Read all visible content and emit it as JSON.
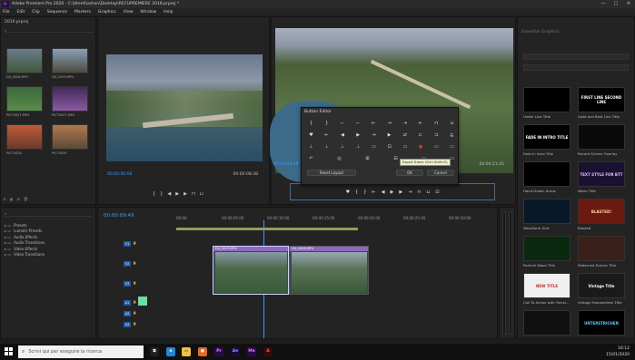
{
  "app": {
    "title": "Adobe Premiere Pro 2020 - C:\\Utenti\\adran\\Desktop\\RECUPREMIERE 2018.prproj *",
    "logo_text": "Pr",
    "window_controls": [
      "—",
      "□",
      "✕"
    ]
  },
  "menu": [
    "File",
    "Edit",
    "Clip",
    "Sequence",
    "Markers",
    "Graphics",
    "View",
    "Window",
    "Help"
  ],
  "project": {
    "tab": "2019.prproj",
    "clips": [
      {
        "label": "DJI_0028.MP4",
        "colors": [
          "#6b7b8a",
          "#3f5a3a"
        ]
      },
      {
        "label": "DJI_0029.MP4",
        "colors": [
          "#8aa0b8",
          "#4b4b3b"
        ]
      },
      {
        "label": "PICT0027.MP4",
        "colors": [
          "#3a6a3a",
          "#5a8a4a"
        ]
      },
      {
        "label": "PICT0027.MP4",
        "colors": [
          "#402a5a",
          "#8a5aa0"
        ]
      },
      {
        "label": "PICT0028",
        "colors": [
          "#c05a3a",
          "#6a3a2a"
        ]
      },
      {
        "label": "PICT0030",
        "colors": [
          "#b07a4a",
          "#5a4a3a"
        ]
      }
    ]
  },
  "source_monitor": {
    "timecode_left": "00:00:00:00",
    "timecode_right": "00:00:08:38"
  },
  "program_monitor": {
    "timecode_left": "00:00:09:49",
    "timecode_right": "00:00:21:45"
  },
  "button_editor": {
    "title": "Button Editor",
    "reset_label": "Reset Layout",
    "ok_label": "OK",
    "cancel_label": "Cancel",
    "tooltip": "Export Frame (Ctrl+Shift+E)",
    "row1": [
      "{",
      "}",
      "⌐",
      "⌐",
      "⇤",
      "⇥",
      "⇥",
      "⇤",
      "⊓",
      "⊔"
    ],
    "row2": [
      "♥",
      "⇤",
      "◀",
      "▶",
      "⇥",
      "▶",
      "⇄",
      "⊏",
      "⊐",
      "⊑"
    ],
    "row3": [
      "⊥",
      "⊥",
      "⊥",
      "⊥",
      "▭",
      "⊡",
      "▭",
      "●",
      "▭",
      "▭"
    ],
    "row4": [
      "↶",
      "◎",
      "⊞",
      "⊟",
      "▭",
      "▭"
    ]
  },
  "effects": {
    "items": [
      "Presets",
      "Lumetri Presets",
      "Audio Effects",
      "Audio Transitions",
      "Video Effects",
      "Video Transitions"
    ]
  },
  "timeline": {
    "timecode": "00:00:09:49",
    "ruler": [
      "00:00",
      "00:00:05:00",
      "00:00:10:00",
      "00:00:15:00",
      "00:00:20:00",
      "00:00:25:00",
      "00:00:30:00"
    ],
    "tracks": [
      "V1",
      "V2",
      "V3",
      "A1",
      "A2",
      "A3"
    ],
    "clip1_label": "DJI_0029.MP4",
    "clip2_label": "DJI_0028.MP4"
  },
  "essential_graphics": {
    "tab": "Essential Graphics",
    "templates": [
      {
        "label": "Under Line Title",
        "text": "",
        "bg": "#000000",
        "fg": "#ffffff"
      },
      {
        "label": "Light and Bold Line Title",
        "text": "FIRST LINE SECOND LINE",
        "bg": "#000000",
        "fg": "#ffffff"
      },
      {
        "label": "Fade In Intro Title",
        "text": "FADE IN INTRO TITLE",
        "bg": "#000000",
        "fg": "#ffffff"
      },
      {
        "label": "Record Screen Overlay",
        "text": "",
        "bg": "#0a0a0a",
        "fg": "#d04040"
      },
      {
        "label": "Hand Drawn Arrow",
        "text": "",
        "bg": "#000000",
        "fg": "#ffffff"
      },
      {
        "label": "Wave Title",
        "text": "TEXT STYLE FOR BTT",
        "bg": "#1a1030",
        "fg": "#e0c0ff"
      },
      {
        "label": "Waveform Grid",
        "text": "",
        "bg": "#081828",
        "fg": "#30a0ff"
      },
      {
        "label": "Blasted",
        "text": "BLASTED!",
        "bg": "#6a1a10",
        "fg": "#ffd0a0"
      },
      {
        "label": "Particle Wave Title",
        "text": "",
        "bg": "#0a2a10",
        "fg": "#40e060"
      },
      {
        "label": "Patterned Eclipse Title",
        "text": "",
        "bg": "#3a2018",
        "fg": "#e0c0a0"
      },
      {
        "label": "Call To Action with Tracki...",
        "text": "NEW TITLE",
        "bg": "#f0f0f0",
        "fg": "#c03030"
      },
      {
        "label": "Vintage Handwritten Title",
        "text": "Vintage Title",
        "bg": "#1a1a1a",
        "fg": "#ffffff"
      },
      {
        "label": "",
        "text": "",
        "bg": "#101010",
        "fg": "#ffffff"
      },
      {
        "label": "",
        "text": "UNTERSTRICHEN",
        "bg": "#000000",
        "fg": "#5ad0ff"
      }
    ]
  },
  "taskbar": {
    "search_placeholder": "Scrivi qui per eseguire la ricerca",
    "time": "16:12",
    "date": "15/01/2020"
  }
}
